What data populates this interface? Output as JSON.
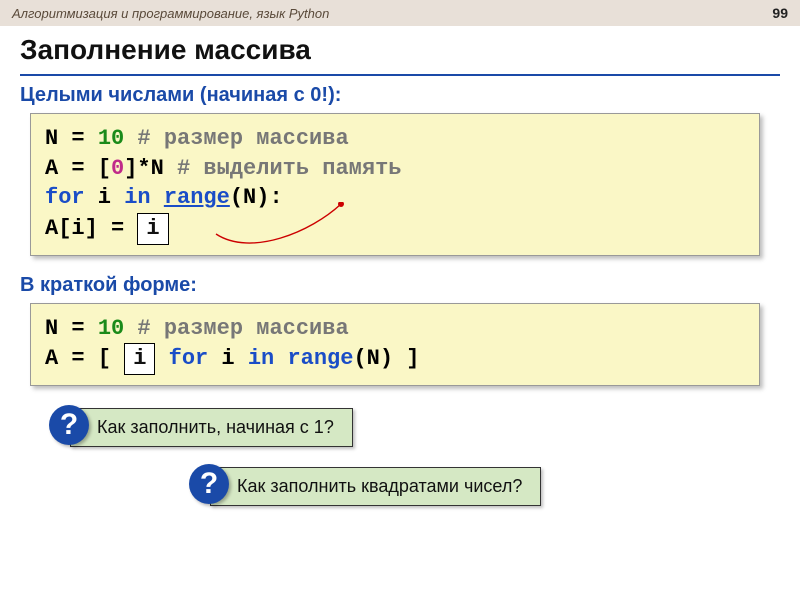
{
  "header": {
    "breadcrumb": "Алгоритмизация и программирование, язык Python",
    "page_number": "99"
  },
  "title": "Заполнение массива",
  "section1_label": "Целыми числами (начиная с 0!):",
  "code1": {
    "line1_a": "N = ",
    "line1_num": "10",
    "line1_comment": "     # размер массива",
    "line2_a": "A = [",
    "line2_zero": "0",
    "line2_b": "]*N  ",
    "line2_comment": "# выделить память",
    "line3_for": "for",
    "line3_mid": " i ",
    "line3_in": "in",
    "line3_sp": " ",
    "line3_range": "range",
    "line3_end": "(N):",
    "line4_a": "   A[i] = ",
    "callout_i": "i"
  },
  "section2_label": "В краткой форме:",
  "code2": {
    "line1_a": "N = ",
    "line1_num": "10",
    "line1_comment": "      # размер массива",
    "line2_a": "A = [ ",
    "callout_i": "i",
    "line2_sp": " ",
    "line2_for": "for",
    "line2_mid": " i ",
    "line2_in": "in",
    "line2_sp2": " ",
    "line2_range": "range",
    "line2_end": "(N) ]"
  },
  "question1": "Как заполнить, начиная с 1?",
  "question2": "Как заполнить квадратами чисел?",
  "q_mark": "?"
}
